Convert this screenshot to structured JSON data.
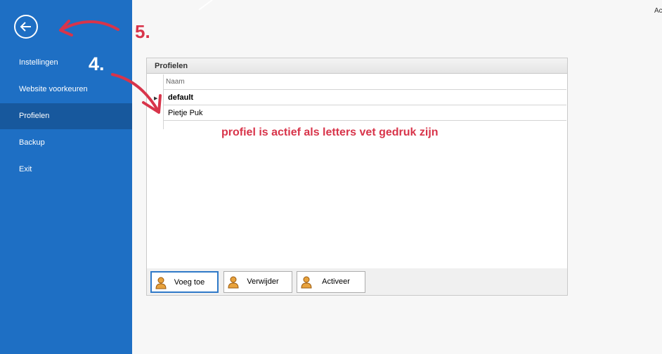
{
  "sidebar": {
    "items": [
      {
        "label": "Instellingen"
      },
      {
        "label": "Website voorkeuren"
      },
      {
        "label": "Profielen"
      },
      {
        "label": "Backup"
      },
      {
        "label": "Exit"
      }
    ]
  },
  "top_right_text": "Ac",
  "panel": {
    "title": "Profielen",
    "column_header": "Naam",
    "rows": [
      {
        "name": "default",
        "active": true
      },
      {
        "name": "Pietje Puk",
        "active": false
      }
    ],
    "buttons": {
      "add": "Voeg toe",
      "remove": "Verwijder",
      "activate": "Activeer"
    }
  },
  "annotations": {
    "step4": "4.",
    "step5": "5.",
    "note": "profiel is actief als letters vet gedruk zijn",
    "color": "#d8344a"
  },
  "colors": {
    "sidebar": "#1e6fc4",
    "sidebar_active": "#17589d"
  }
}
